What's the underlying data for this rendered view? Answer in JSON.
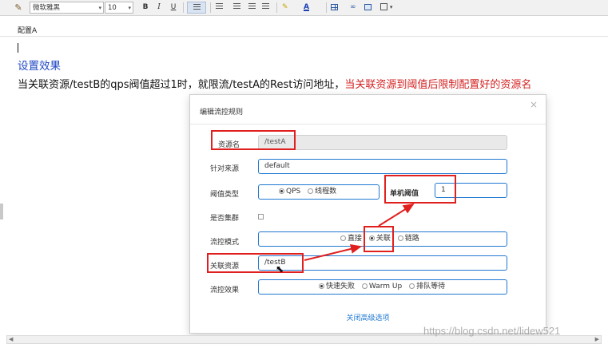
{
  "toolbar": {
    "font_name": "微软雅黑",
    "font_size": "10",
    "bold": "B",
    "italic": "I",
    "underline": "U",
    "font_color_glyph": "A",
    "highlight_glyph": "✎",
    "dropdown_glyph": "▾"
  },
  "editor": {
    "label_a": "配置A",
    "heading": "设置效果",
    "desc_main": "当关联资源/testB的qps阀值超过1时，就限流/testA的Rest访问地址，",
    "desc_red": "当关联资源到阈值后限制配置好的资源名"
  },
  "dialog": {
    "title": "编辑流控规则",
    "close": "×",
    "resource_label": "资源名",
    "resource_value": "/testA",
    "source_label": "针对来源",
    "source_value": "default",
    "threshold_type_label": "阈值类型",
    "threshold_type_options": [
      "QPS",
      "线程数"
    ],
    "threshold_label": "单机阈值",
    "threshold_value": "1",
    "cluster_label": "是否集群",
    "mode_label": "流控模式",
    "mode_options": [
      "直接",
      "关联",
      "链路"
    ],
    "related_label": "关联资源",
    "related_value": "/testB",
    "effect_label": "流控效果",
    "effect_options": [
      "快速失败",
      "Warm Up",
      "排队等待"
    ],
    "advanced_link": "关闭高级选项"
  },
  "watermark": "https://blog.csdn.net/lidew521",
  "colors": {
    "annotation_red": "#e0201e",
    "heading_blue": "#1f48c4",
    "field_border": "#1f78d1"
  }
}
